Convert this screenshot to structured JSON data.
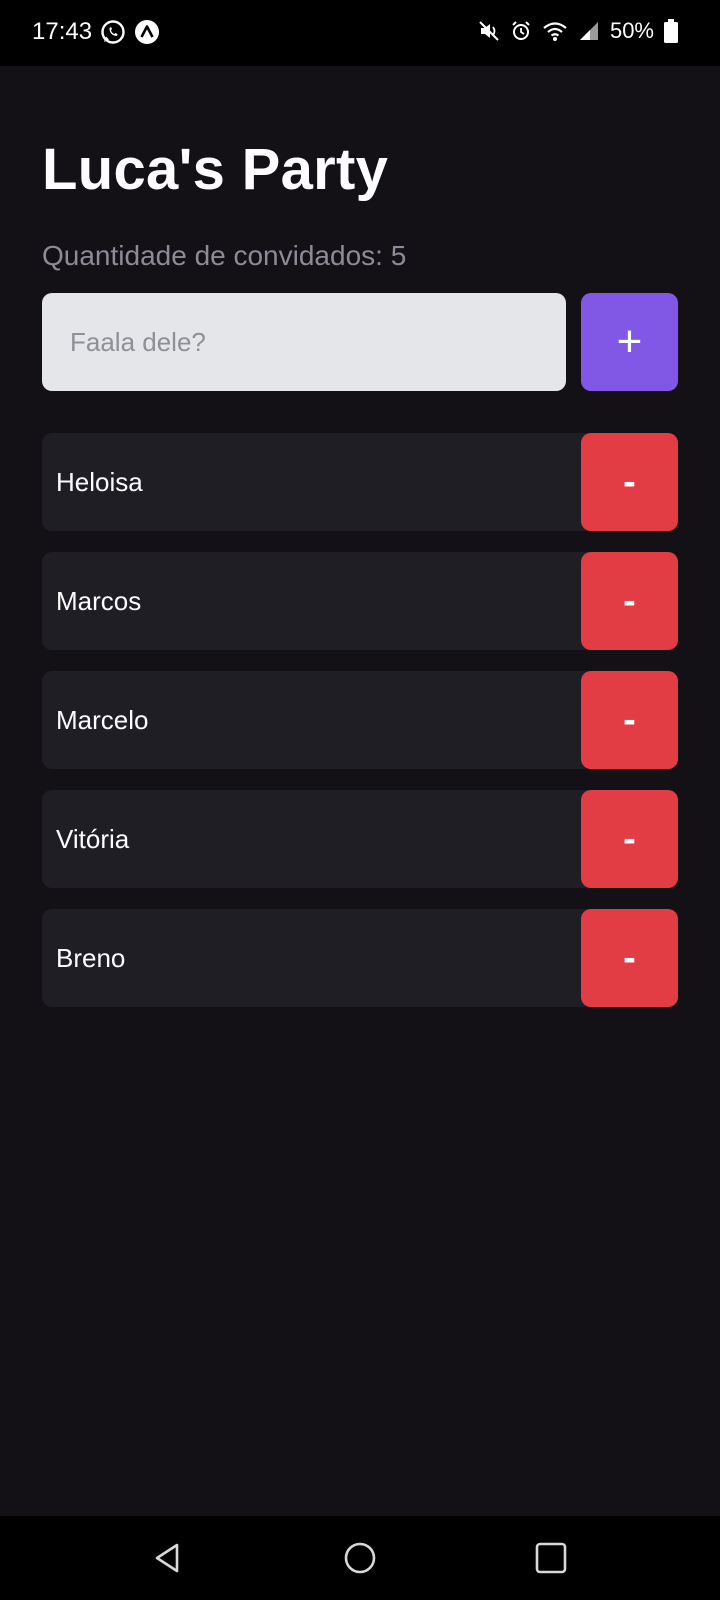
{
  "status_bar": {
    "time": "17:43",
    "battery": "50%",
    "left_icons": [
      "whatsapp-icon",
      "app-notification-icon"
    ],
    "right_icons": [
      "mute-vibrate-icon",
      "alarm-icon",
      "wifi-icon",
      "signal-icon",
      "battery-icon"
    ]
  },
  "header": {
    "title": "Luca's Party",
    "guest_count_text": "Quantidade de convidados: 5"
  },
  "form": {
    "input_placeholder": "Faala dele?",
    "input_value": "",
    "add_label": "+"
  },
  "guests": [
    {
      "name": "Heloisa",
      "remove_label": "-"
    },
    {
      "name": "Marcos",
      "remove_label": "-"
    },
    {
      "name": "Marcelo",
      "remove_label": "-"
    },
    {
      "name": "Vitória",
      "remove_label": "-"
    },
    {
      "name": "Breno",
      "remove_label": "-"
    }
  ],
  "nav": {
    "icons": [
      "back-icon",
      "home-icon",
      "recents-icon"
    ]
  },
  "colors": {
    "background": "#131016",
    "card": "#1f1e25",
    "accent_add": "#8157e6",
    "accent_remove": "#e23c44",
    "input_bg": "#e5e6ea"
  }
}
